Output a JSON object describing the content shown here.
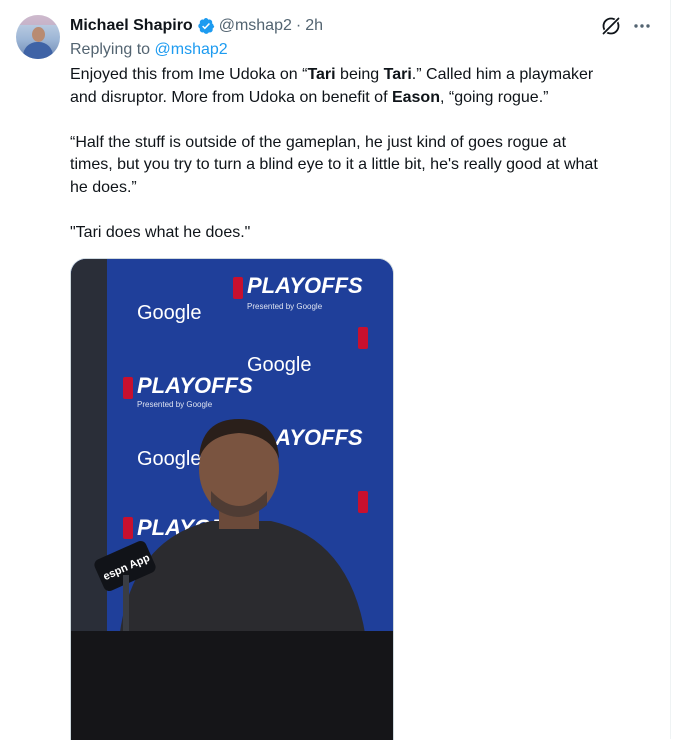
{
  "tweet": {
    "author_name": "Michael Shapiro",
    "handle": "@mshap2",
    "separator": "·",
    "time": "2h",
    "replying_prefix": "Replying to",
    "replying_handle": "@mshap2",
    "text": {
      "l1_a": "Enjoyed this from Ime Udoka on “",
      "l1_b1": "Tari",
      "l1_c": " being ",
      "l1_b2": "Tari",
      "l1_d": ".” Called him a playmaker",
      "l2_a": "and disruptor. More from Udoka on benefit of ",
      "l2_b": "Eason",
      "l2_c": ", “going rogue.”",
      "quote_l1": "“Half the stuff is outside of the gameplan, he just kind of goes rogue at",
      "quote_l2": "times, but you try to turn a blind eye to it a little bit, he's really good at what",
      "quote_l3": "he does.”",
      "closing": "\"Tari does what he does.\""
    }
  },
  "icons": {
    "verified": "verified-badge-icon",
    "grok": "grok-icon",
    "more": "more-icon"
  },
  "colors": {
    "accent": "#1d9bf0",
    "secondary_text": "#536471",
    "backdrop_blue": "#1f3f9a"
  },
  "media": {
    "backdrop_logos": [
      "Google",
      "PLAYOFFS",
      "Presented by Google"
    ],
    "mic_label": "espn App"
  }
}
